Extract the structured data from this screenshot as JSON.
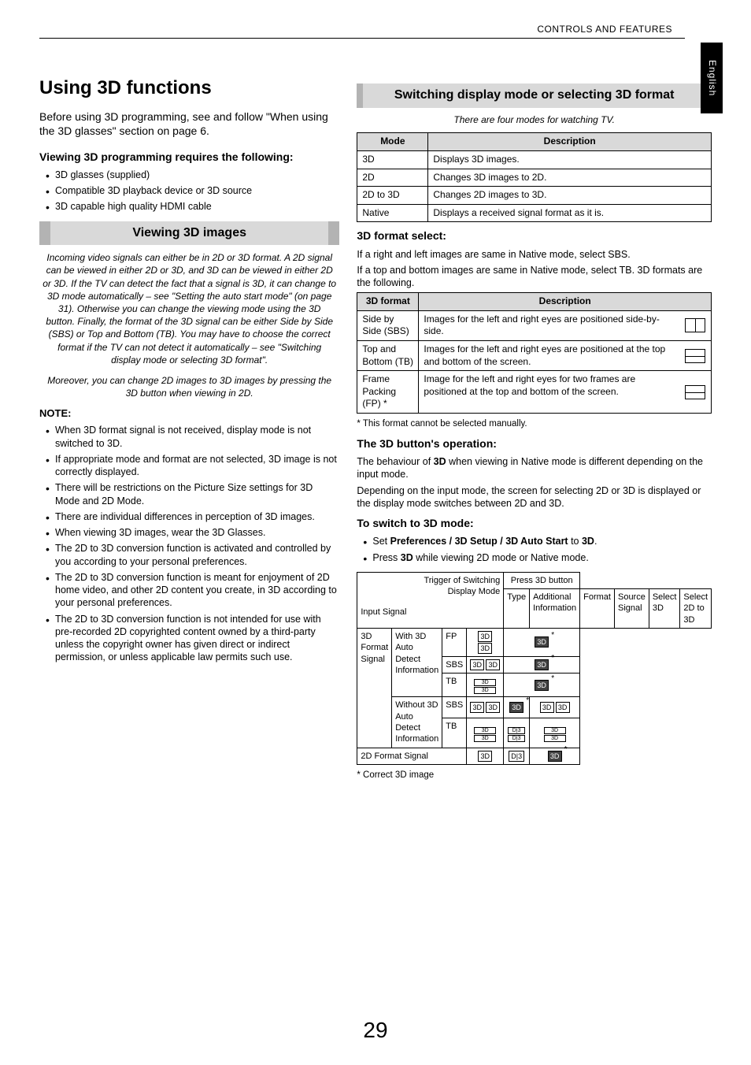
{
  "header": {
    "section": "CONTROLS AND FEATURES",
    "tab": "English"
  },
  "page_number": "29",
  "left": {
    "title": "Using 3D functions",
    "intro": "Before using 3D programming, see and follow \"When using the 3D glasses\" section on page 6.",
    "req_head": "Viewing 3D programming requires the following:",
    "req_items": [
      "3D glasses (supplied)",
      "Compatible 3D playback device or 3D source",
      "3D capable high quality HDMI cable"
    ],
    "section1": "Viewing 3D images",
    "para_italic1": "Incoming video signals can either be in 2D or 3D format. A 2D signal can be viewed in either 2D or 3D, and 3D can be viewed in either 2D or 3D. If the TV can detect the fact that a signal is 3D, it can change to 3D mode automatically – see \"Setting the auto start mode\" (on page 31). Otherwise you can change the viewing mode using the 3D button. Finally, the format of the 3D signal can be either Side by Side (SBS) or Top and Bottom (TB). You may have to choose the correct format if the TV can not detect it automatically – see \"Switching display mode or selecting 3D format\".",
    "para_italic2": "Moreover, you can change 2D images to 3D images by pressing the 3D button when viewing in 2D.",
    "note_head": "NOTE:",
    "notes": [
      "When 3D format signal is not received, display mode is not switched to 3D.",
      "If appropriate mode and format are not selected, 3D image is not correctly displayed.",
      "There will be restrictions on the Picture Size settings for 3D Mode and 2D Mode.",
      "There are individual differences in perception of 3D images.",
      "When viewing 3D images, wear the 3D Glasses.",
      "The 2D to 3D conversion function is activated and controlled by you according to your personal preferences.",
      "The 2D to 3D conversion function is meant for enjoyment of 2D home video, and other 2D content you create, in 3D according to your personal preferences.",
      "The 2D to 3D conversion function is not intended for use with pre-recorded 2D copyrighted content owned by a third-party unless the copyright owner has given direct or indirect permission, or unless applicable law permits such use."
    ]
  },
  "right": {
    "section2": "Switching display mode or selecting 3D format",
    "modes_intro": "There are four modes for watching TV.",
    "modes_table": {
      "h1": "Mode",
      "h2": "Description",
      "rows": [
        {
          "c1": "3D",
          "c2": "Displays 3D images."
        },
        {
          "c1": "2D",
          "c2": "Changes 3D images to 2D."
        },
        {
          "c1": "2D to 3D",
          "c2": "Changes 2D images to 3D."
        },
        {
          "c1": "Native",
          "c2": "Displays a received signal format as it is."
        }
      ]
    },
    "fmt_head": "3D format select:",
    "fmt_p1": "If a right and left images are same in Native mode, select SBS.",
    "fmt_p2": "If a top and bottom images are same in Native mode, select TB. 3D formats are the following.",
    "fmt_table": {
      "h1": "3D format",
      "h2": "Description",
      "rows": [
        {
          "c1": "Side by Side (SBS)",
          "c2": "Images for the left and right eyes are positioned side-by-side.",
          "icon": "sbs"
        },
        {
          "c1": "Top and Bottom (TB)",
          "c2": "Images for the left and right eyes are positioned at the top and bottom of the screen.",
          "icon": "tb"
        },
        {
          "c1": "Frame Packing (FP) *",
          "c2": "Image for the left and right eyes for two frames are positioned at the top and bottom of the screen.",
          "icon": "tb"
        }
      ]
    },
    "fmt_foot": "*  This format cannot be selected manually.",
    "btn_head": "The 3D button's operation:",
    "btn_p1": "The behaviour of 3D when viewing in Native mode is different depending on the input mode.",
    "btn_bold": "3D",
    "btn_p2": "Depending on the input mode, the screen for selecting 2D or 3D is displayed or the display mode switches between 2D and 3D.",
    "switch_head": "To switch to 3D mode:",
    "switch_b1a": "Set ",
    "switch_b1b": "Preferences / 3D Setup / 3D Auto Start",
    "switch_b1c": " to ",
    "switch_b1d": "3D",
    "switch_b1e": ".",
    "switch_b2a": "Press ",
    "switch_b2b": "3D",
    "switch_b2c": " while viewing 2D mode or Native mode.",
    "table3": {
      "trig1": "Trigger of Switching",
      "trig2": "Display Mode",
      "press": "Press 3D button",
      "input": "Input Signal",
      "type": "Type",
      "addl": "Additional Information",
      "format": "Format",
      "source": "Source Signal",
      "sel3d": "Select 3D",
      "sel2d3d": "Select 2D to 3D",
      "r1_type": "3D Format Signal",
      "r1_addl": "With 3D Auto Detect Information",
      "r1_f1": "FP",
      "r1_f2": "SBS",
      "r1_f3": "TB",
      "r2_addl": "Without 3D Auto Detect Information",
      "r2_f1": "SBS",
      "r2_f2": "TB",
      "r3_type": "2D Format Signal"
    },
    "correct": "*  Correct 3D image"
  },
  "icons": {
    "threeD": "3D",
    "d3": "D|3"
  }
}
